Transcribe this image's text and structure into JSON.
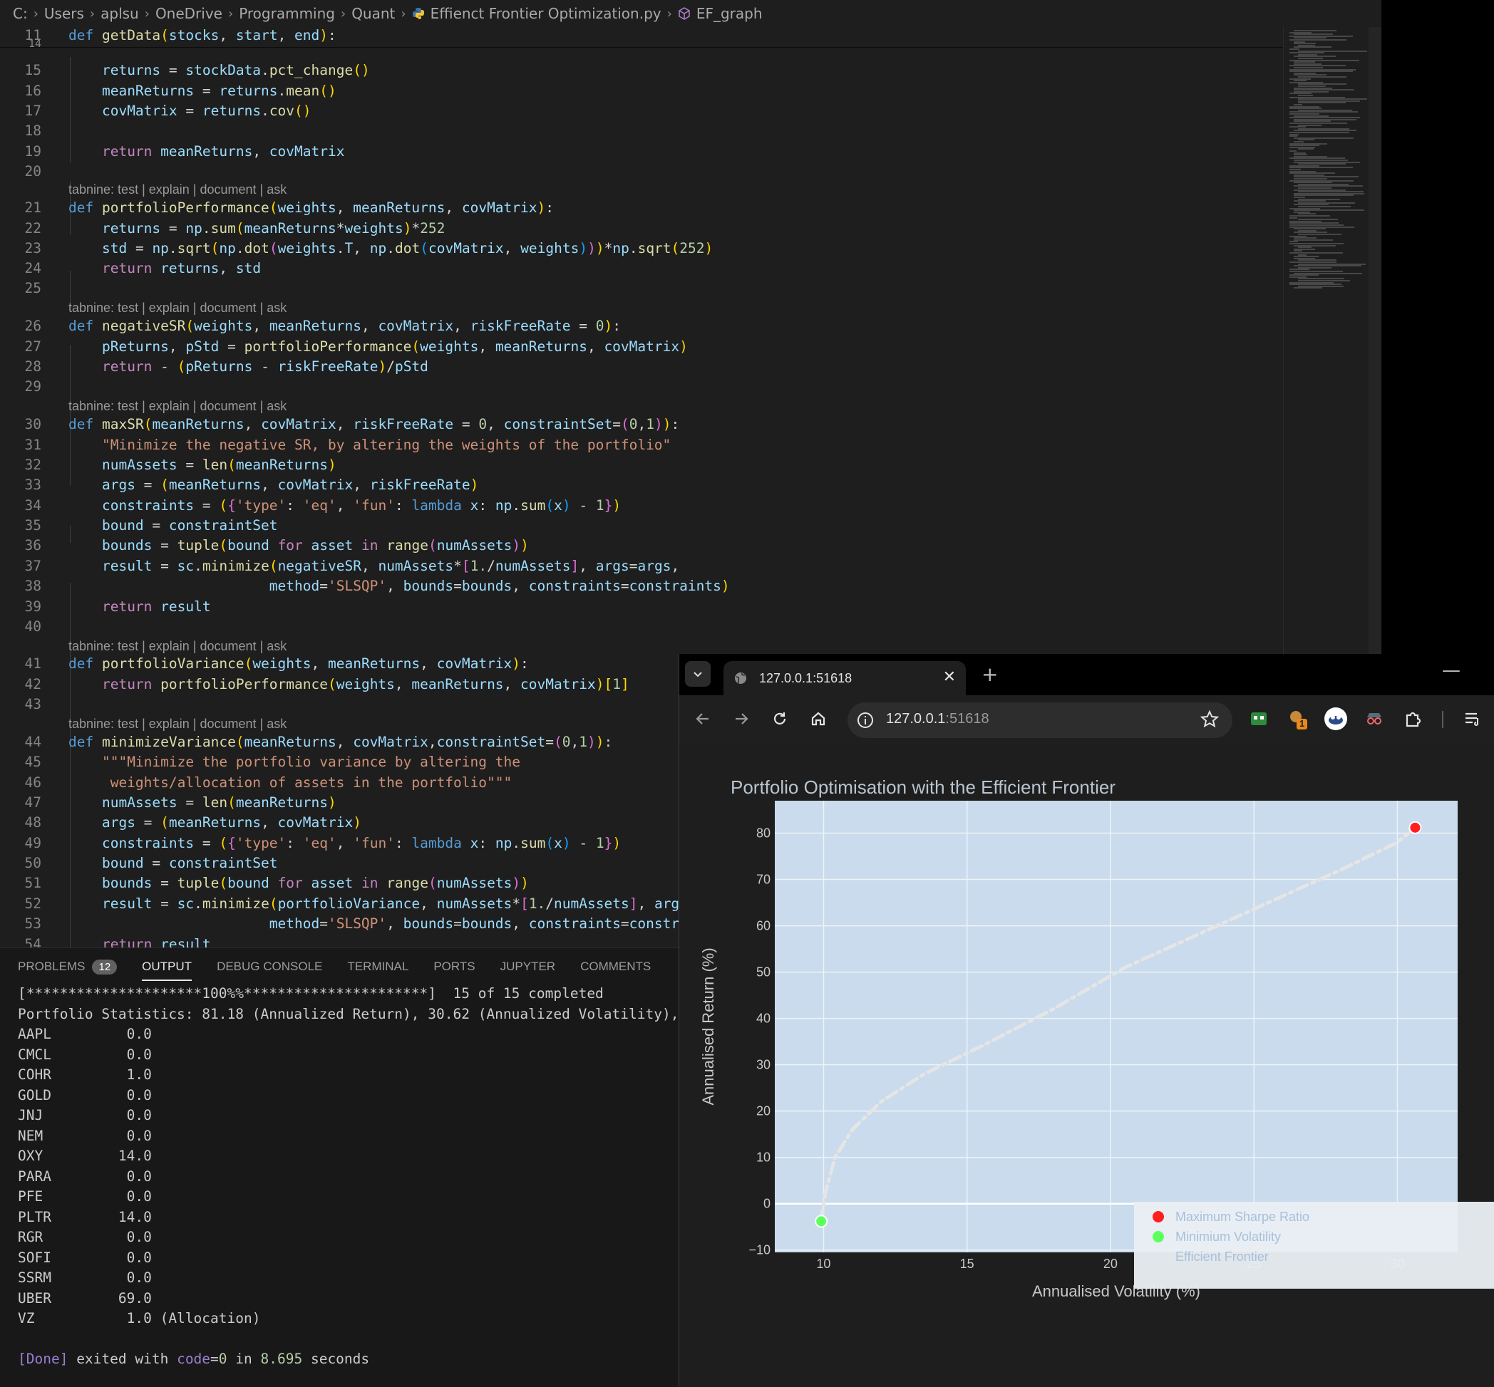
{
  "breadcrumb": {
    "items": [
      "C:",
      "Users",
      "aplsu",
      "OneDrive",
      "Programming",
      "Quant"
    ],
    "file": "Effienct Frontier Optimization.py",
    "symbol": "EF_graph"
  },
  "code_lens": "tabnine: test | explain | document | ask",
  "editor": {
    "lines": [
      {
        "n": "11",
        "t": "sticky"
      },
      {
        "n": "14",
        "t": "blank"
      },
      {
        "n": "15"
      },
      {
        "n": "16"
      },
      {
        "n": "17"
      },
      {
        "n": "18"
      },
      {
        "n": "19"
      },
      {
        "n": "20"
      },
      {
        "n": "21"
      },
      {
        "n": "22"
      },
      {
        "n": "23"
      },
      {
        "n": "24"
      },
      {
        "n": "25"
      },
      {
        "n": "26"
      },
      {
        "n": "27"
      },
      {
        "n": "28"
      },
      {
        "n": "29"
      },
      {
        "n": "30"
      },
      {
        "n": "31"
      },
      {
        "n": "32"
      },
      {
        "n": "33"
      },
      {
        "n": "34"
      },
      {
        "n": "35"
      },
      {
        "n": "36"
      },
      {
        "n": "37"
      },
      {
        "n": "38"
      },
      {
        "n": "39"
      },
      {
        "n": "40"
      },
      {
        "n": "41"
      },
      {
        "n": "42"
      },
      {
        "n": "43"
      },
      {
        "n": "44"
      },
      {
        "n": "45"
      },
      {
        "n": "46"
      },
      {
        "n": "47"
      },
      {
        "n": "48"
      },
      {
        "n": "49"
      },
      {
        "n": "50"
      },
      {
        "n": "51"
      },
      {
        "n": "52"
      },
      {
        "n": "53"
      },
      {
        "n": "54"
      }
    ]
  },
  "panel": {
    "tabs": [
      "PROBLEMS",
      "OUTPUT",
      "DEBUG CONSOLE",
      "TERMINAL",
      "PORTS",
      "JUPYTER",
      "COMMENTS"
    ],
    "problems_count": "12",
    "active_tab": "OUTPUT",
    "output_lines": [
      "[*********************100%%**********************]  15 of 15 completed",
      "Portfolio Statistics: 81.18 (Annualized Return), 30.62 (Annualized Volatility),",
      "AAPL         0.0",
      "CMCL         0.0",
      "COHR         1.0",
      "GOLD         0.0",
      "JNJ          0.0",
      "NEM          0.0",
      "OXY         14.0",
      "PARA         0.0",
      "PFE          0.0",
      "PLTR        14.0",
      "RGR          0.0",
      "SOFI         0.0",
      "SSRM         0.0",
      "UBER        69.0",
      "VZ           1.0 (Allocation)",
      "",
      "[Done] exited with code=0 in 8.695 seconds"
    ]
  },
  "browser": {
    "tab_title": "127.0.0.1:51618",
    "url_host": "127.0.0.1",
    "url_port": ":51618",
    "extension_badge": "1",
    "icons": {
      "tab_menu": "chevron-down-icon",
      "back": "back-arrow-icon",
      "forward": "forward-arrow-icon",
      "reload": "reload-icon",
      "home": "home-icon",
      "info": "info-icon",
      "star": "star-icon"
    }
  },
  "colors": {
    "plot_bg": "#c9dbec",
    "max_sharpe": "#ff1f1f",
    "min_vol": "#5dff5d",
    "frontier": "#e5e5e5"
  },
  "chart_data": {
    "type": "scatter",
    "title": "Portfolio Optimisation with the Efficient Frontier",
    "xlabel": "Annualised Volatility (%)",
    "ylabel": "Annualised Return (%)",
    "xlim": [
      8.3,
      32.1
    ],
    "ylim": [
      -10.5,
      87
    ],
    "x_ticks": [
      10,
      15,
      20,
      25,
      30
    ],
    "y_ticks": [
      -10,
      0,
      10,
      20,
      30,
      40,
      50,
      60,
      70,
      80
    ],
    "legend_position": "bottom-right",
    "series": [
      {
        "name": "Maximum Sharpe Ratio",
        "mode": "markers",
        "x": [
          30.62
        ],
        "y": [
          81.18
        ]
      },
      {
        "name": "Minimium Volatility",
        "mode": "markers",
        "x": [
          9.92
        ],
        "y": [
          -3.8
        ]
      },
      {
        "name": "Efficient Frontier",
        "mode": "lines",
        "dash": "dashdot",
        "x": [
          9.92,
          10.05,
          10.4,
          11.0,
          12.0,
          13.5,
          15.5,
          18.0,
          20.5,
          23.0,
          25.5,
          28.0,
          30.0,
          30.62
        ],
        "y": [
          -3.8,
          2,
          10,
          16,
          22,
          28,
          34,
          42,
          51,
          58,
          65,
          72,
          78,
          81.18
        ]
      }
    ]
  }
}
